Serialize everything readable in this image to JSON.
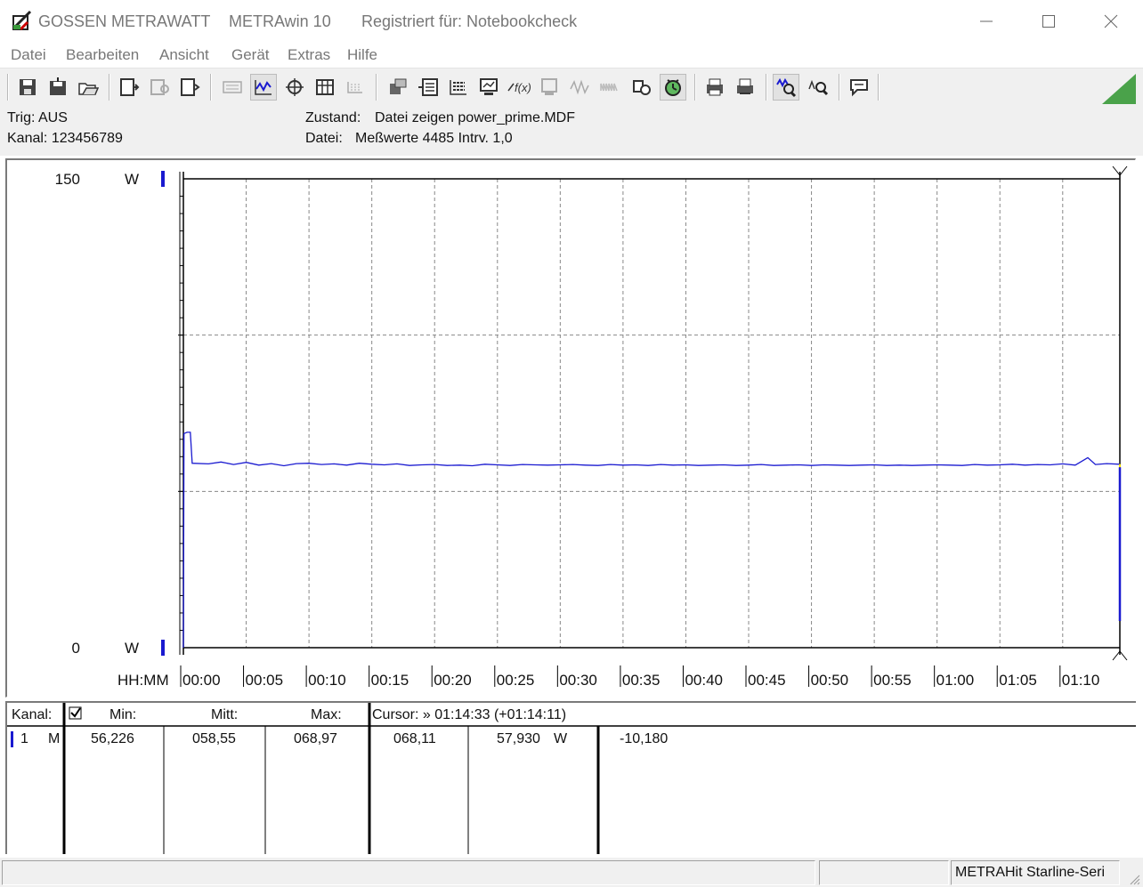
{
  "window": {
    "brand": "GOSSEN METRAWATT",
    "app_name": "METRAwin 10",
    "registration": "Registriert für: Notebookcheck"
  },
  "menu": [
    "Datei",
    "Bearbeiten",
    "Ansicht",
    "Gerät",
    "Extras",
    "Hilfe"
  ],
  "toolbar_icons": [
    "save-icon",
    "save-as-icon",
    "open-folder-icon",
    "device-read-icon",
    "device-config-icon",
    "device-send-icon",
    "keyboard-icon",
    "measure-mode-icon",
    "target-icon",
    "table-icon",
    "grid-icon",
    "export-icon",
    "list-export-icon",
    "data-list-icon",
    "computer-icon",
    "formula-icon",
    "display-icon",
    "waveform-icon",
    "waveform-disabled-icon",
    "sensor-icon",
    "clock-icon",
    "print-preview-icon",
    "print-icon",
    "zoom-waveform-icon",
    "zoom-icon",
    "message-icon"
  ],
  "info": {
    "trig": "Trig: AUS",
    "kanal": "Kanal: 123456789",
    "zustand_label": "Zustand:",
    "zustand_value": "Datei zeigen power_prime.MDF",
    "datei_label": "Datei:",
    "datei_value": "Meßwerte 4485  Intrv. 1,0"
  },
  "chart_data": {
    "type": "line",
    "ylim": [
      0,
      150
    ],
    "y_top_label": "150",
    "y_bottom_label": "0",
    "y_unit": "W",
    "x_axis_label": "HH:MM",
    "x_ticks": [
      "00:00",
      "00:05",
      "00:10",
      "00:15",
      "00:20",
      "00:25",
      "00:30",
      "00:35",
      "00:40",
      "00:45",
      "00:50",
      "00:55",
      "01:00",
      "01:05",
      "01:10"
    ],
    "x_range_minutes": [
      0,
      74.55
    ],
    "series": [
      {
        "color": "#1a1ad0",
        "points": [
          [
            0,
            0
          ],
          [
            0.05,
            68.5
          ],
          [
            0.3,
            68.9
          ],
          [
            0.55,
            68.9
          ],
          [
            0.7,
            59.0
          ],
          [
            2,
            58.8
          ],
          [
            3,
            59.4
          ],
          [
            4,
            58.6
          ],
          [
            5,
            59.3
          ],
          [
            6,
            58.4
          ],
          [
            7,
            58.9
          ],
          [
            8,
            58.2
          ],
          [
            9,
            58.9
          ],
          [
            10,
            59.0
          ],
          [
            11,
            58.6
          ],
          [
            12,
            58.8
          ],
          [
            13,
            58.4
          ],
          [
            14,
            59.0
          ],
          [
            15,
            58.7
          ],
          [
            16,
            58.5
          ],
          [
            17,
            58.8
          ],
          [
            18,
            58.3
          ],
          [
            19,
            58.5
          ],
          [
            20,
            58.6
          ],
          [
            21,
            58.3
          ],
          [
            22,
            58.4
          ],
          [
            23,
            58.2
          ],
          [
            24,
            58.7
          ],
          [
            25,
            58.5
          ],
          [
            26,
            58.3
          ],
          [
            27,
            58.6
          ],
          [
            28,
            58.5
          ],
          [
            29,
            58.4
          ],
          [
            30,
            58.5
          ],
          [
            31,
            58.6
          ],
          [
            32,
            58.4
          ],
          [
            33,
            58.3
          ],
          [
            34,
            58.6
          ],
          [
            35,
            58.4
          ],
          [
            36,
            58.5
          ],
          [
            37,
            58.3
          ],
          [
            38,
            58.6
          ],
          [
            39,
            58.4
          ],
          [
            40,
            58.5
          ],
          [
            41,
            58.3
          ],
          [
            42,
            58.4
          ],
          [
            43,
            58.5
          ],
          [
            44,
            58.3
          ],
          [
            45,
            58.4
          ],
          [
            46,
            58.6
          ],
          [
            47,
            58.3
          ],
          [
            48,
            58.4
          ],
          [
            49,
            58.5
          ],
          [
            50,
            58.3
          ],
          [
            51,
            58.5
          ],
          [
            52,
            58.4
          ],
          [
            53,
            58.3
          ],
          [
            54,
            58.4
          ],
          [
            55,
            58.5
          ],
          [
            56,
            58.3
          ],
          [
            57,
            58.4
          ],
          [
            58,
            58.3
          ],
          [
            59,
            58.4
          ],
          [
            60,
            58.5
          ],
          [
            61,
            58.4
          ],
          [
            62,
            58.3
          ],
          [
            63,
            58.6
          ],
          [
            64,
            58.4
          ],
          [
            65,
            58.5
          ],
          [
            66,
            58.7
          ],
          [
            67,
            58.4
          ],
          [
            68,
            58.6
          ],
          [
            69,
            58.5
          ],
          [
            70,
            58.8
          ],
          [
            71,
            58.4
          ],
          [
            72,
            60.8
          ],
          [
            72.6,
            58.6
          ],
          [
            73.5,
            58.9
          ],
          [
            74.55,
            58.7
          ]
        ]
      }
    ]
  },
  "table": {
    "headers": {
      "kanal": "Kanal:",
      "min": "Min:",
      "mitt": "Mitt:",
      "max": "Max:",
      "cursor": "Cursor: » 01:14:33 (+01:14:11)"
    },
    "row": {
      "channel": "1",
      "mode": "M",
      "min": "56,226",
      "mitt": "058,55",
      "max": "068,97",
      "cursor_value": "068,11",
      "value": "57,930",
      "unit": "W",
      "delta": "-10,180"
    }
  },
  "status": {
    "device": "METRAHit Starline-Seri"
  }
}
